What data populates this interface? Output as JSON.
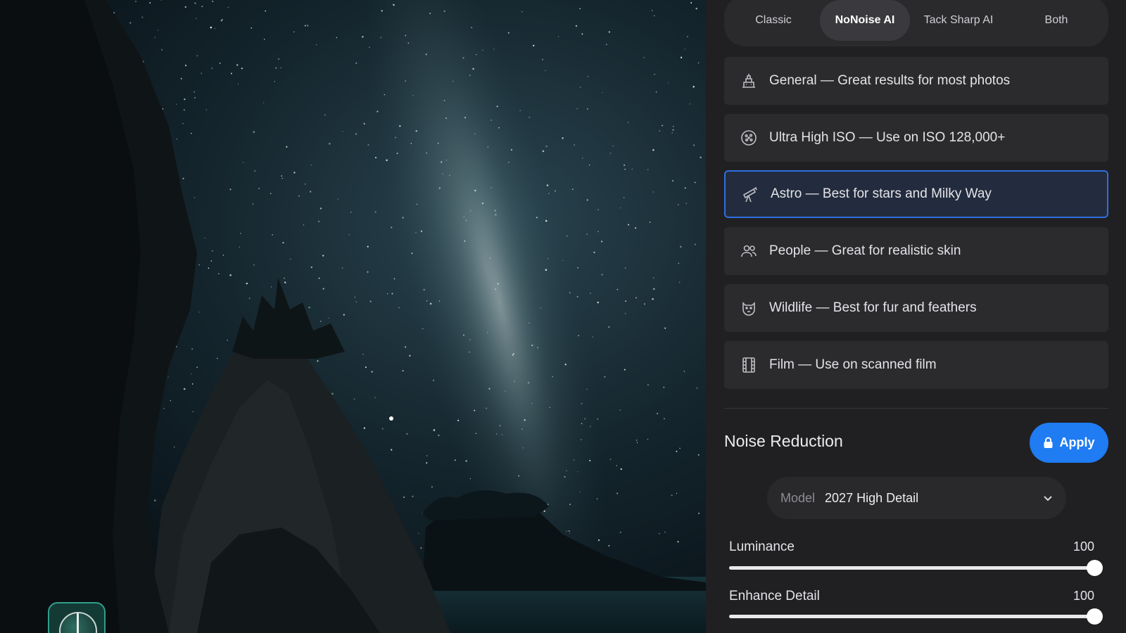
{
  "mode_tabs": [
    {
      "label": "Classic",
      "active": false
    },
    {
      "label": "NoNoise AI",
      "active": true
    },
    {
      "label": "Tack Sharp AI",
      "active": false
    },
    {
      "label": "Both",
      "active": false
    }
  ],
  "presets": [
    {
      "label": "General — Great results for most photos",
      "icon": "landmark-icon",
      "selected": false
    },
    {
      "label": "Ultra High ISO — Use on ISO 128,000+",
      "icon": "iso-dial-icon",
      "selected": false
    },
    {
      "label": "Astro — Best for stars and Milky Way",
      "icon": "telescope-icon",
      "selected": true
    },
    {
      "label": "People — Great for realistic skin",
      "icon": "people-icon",
      "selected": false
    },
    {
      "label": "Wildlife — Best for fur and feathers",
      "icon": "animal-head-icon",
      "selected": false
    },
    {
      "label": "Film — Use on scanned film",
      "icon": "film-strip-icon",
      "selected": false
    }
  ],
  "noise_reduction": {
    "title": "Noise Reduction",
    "apply_label": "Apply",
    "model_key": "Model",
    "model_value": "2027 High Detail"
  },
  "sliders": [
    {
      "label": "Luminance",
      "value": "100",
      "fraction": 1.0
    },
    {
      "label": "Enhance Detail",
      "value": "100",
      "fraction": 1.0
    }
  ],
  "colors": {
    "accent": "#1f7cf2",
    "selected_border": "#2f6fe0",
    "panel_bg": "#202023"
  }
}
